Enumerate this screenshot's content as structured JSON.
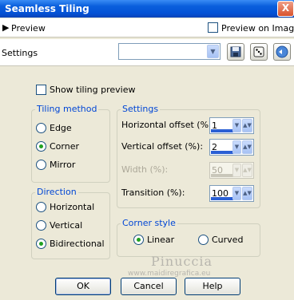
{
  "window": {
    "title": "Seamless Tiling",
    "close_glyph": "X"
  },
  "preview": {
    "label": "Preview",
    "preview_on_image_label": "Preview on Image",
    "preview_on_image_checked": false
  },
  "settings_bar": {
    "label": "Settings",
    "preset_value": ""
  },
  "show_tiling_preview": {
    "label": "Show tiling preview",
    "checked": false
  },
  "tiling_method": {
    "title": "Tiling method",
    "options": [
      "Edge",
      "Corner",
      "Mirror"
    ],
    "selected": "Corner"
  },
  "settings": {
    "title": "Settings",
    "horizontal_offset": {
      "label": "Horizontal offset (%):",
      "value": "1"
    },
    "vertical_offset": {
      "label": "Vertical offset (%):",
      "value": "2"
    },
    "width": {
      "label": "Width (%):",
      "value": "50",
      "enabled": false
    },
    "transition": {
      "label": "Transition (%):",
      "value": "100"
    }
  },
  "direction": {
    "title": "Direction",
    "options": [
      "Horizontal",
      "Vertical",
      "Bidirectional"
    ],
    "selected": "Bidirectional"
  },
  "corner_style": {
    "title": "Corner style",
    "options": [
      "Linear",
      "Curved"
    ],
    "selected": "Linear"
  },
  "watermark": {
    "name": "Pinuccia",
    "url": "www.maidiregrafica.eu"
  },
  "buttons": {
    "ok": "OK",
    "cancel": "Cancel",
    "help": "Help"
  }
}
